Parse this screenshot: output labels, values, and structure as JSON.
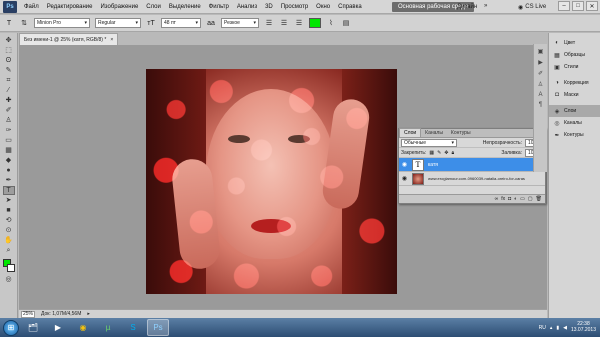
{
  "menubar": {
    "logo": "Ps",
    "items": [
      "Файл",
      "Редактирование",
      "Изображение",
      "Слои",
      "Выделение",
      "Фильтр",
      "Анализ",
      "3D",
      "Просмотр",
      "Окно",
      "Справка"
    ],
    "zoom": "25%",
    "workspace_button": "Основная рабочая среда",
    "design_label": "Дизайн",
    "cslive": "CS Live"
  },
  "options": {
    "font_family": "Minion Pro",
    "font_style": "Regular",
    "font_size": "48 пт",
    "anti_alias": "Резкое",
    "text_color": "#00e600"
  },
  "document": {
    "tab_title": "Без имени-1 @ 25% (катя, RGB/8) *",
    "zoom": "25%",
    "status": "Док: 1,07M/4,56M"
  },
  "layers_panel": {
    "tabs": [
      "Слои",
      "Каналы",
      "Контуры"
    ],
    "blend_mode": "Обычные",
    "opacity_label": "Непрозрачность:",
    "opacity_value": "100%",
    "lock_label": "Закрепить:",
    "fill_label": "Заливка:",
    "fill_value": "100%",
    "layers": [
      {
        "name": "катя",
        "type": "text"
      },
      {
        "name": "www.eroglamour.com-0960039-natalia-oreiro-for-caras",
        "type": "image"
      }
    ]
  },
  "right_panel": {
    "groups": [
      [
        "Цвет",
        "Образцы",
        "Стили"
      ],
      [
        "Коррекция",
        "Маски"
      ],
      [
        "Слои",
        "Каналы",
        "Контуры"
      ]
    ],
    "active": "Слои"
  },
  "taskbar": {
    "lang": "RU",
    "time": "22:38",
    "date": "13.07.2013"
  },
  "colors": {
    "accent_selected": "#3d8ee8",
    "foreground": "#00e600"
  }
}
